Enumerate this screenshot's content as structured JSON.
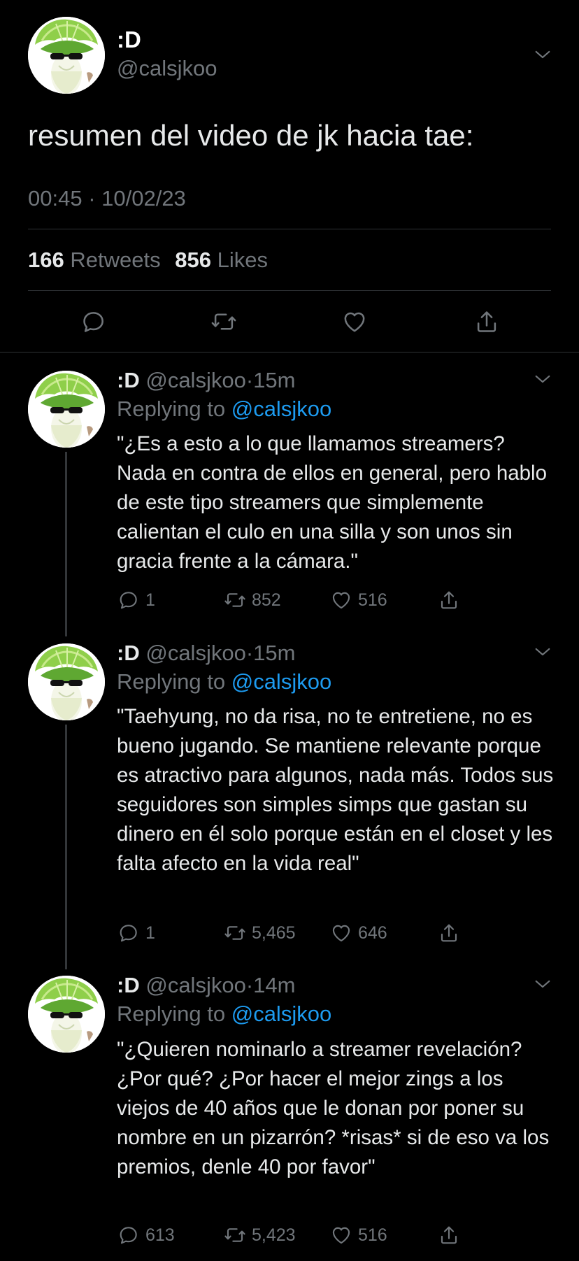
{
  "main_tweet": {
    "display_name": ":D",
    "handle": "@calsjkoo",
    "text": "resumen del video de jk hacia tae:",
    "timestamp": "00:45 · 10/02/23",
    "retweets_count": "166",
    "retweets_label": "Retweets",
    "likes_count": "856",
    "likes_label": "Likes"
  },
  "replies": [
    {
      "display_name": ":D",
      "handle": "@calsjkoo",
      "sep": "·",
      "time": "15m",
      "replying_prefix": "Replying to",
      "replying_handle": "@calsjkoo",
      "text": "\"¿Es a esto a lo que llamamos streamers? Nada en contra de ellos en general, pero hablo de este tipo streamers que simplemente calientan el culo en una silla y son unos sin gracia frente a la cámara.\"",
      "replies": "1",
      "retweets": "852",
      "likes": "516"
    },
    {
      "display_name": ":D",
      "handle": "@calsjkoo",
      "sep": "·",
      "time": "15m",
      "replying_prefix": "Replying to",
      "replying_handle": "@calsjkoo",
      "text": "\"Taehyung, no da risa, no te entretiene, no es bueno jugando. Se mantiene relevante porque es atractivo para algunos, nada más. Todos sus seguidores son simples simps que gastan su dinero en él solo porque están en el closet y les falta afecto en la vida real\"",
      "replies": "1",
      "retweets": "5,465",
      "likes": "646"
    },
    {
      "display_name": ":D",
      "handle": "@calsjkoo",
      "sep": "·",
      "time": "14m",
      "replying_prefix": "Replying to",
      "replying_handle": "@calsjkoo",
      "text": "\"¿Quieren nominarlo a streamer revelación? ¿Por qué? ¿Por hacer el mejor zings a los viejos de 40 años que le donan por poner su nombre en un pizarrón? *risas* si de eso va los premios, denle 40 por favor\"",
      "replies": "613",
      "retweets": "5,423",
      "likes": "516"
    }
  ],
  "icons": {
    "reply": "reply-icon",
    "retweet": "retweet-icon",
    "like": "heart-icon",
    "share": "share-icon",
    "more": "chevron-down-icon"
  },
  "colors": {
    "background": "#000000",
    "text": "#e7e9ea",
    "muted": "#71767b",
    "link": "#1d9bf0",
    "divider": "#2f3336"
  }
}
